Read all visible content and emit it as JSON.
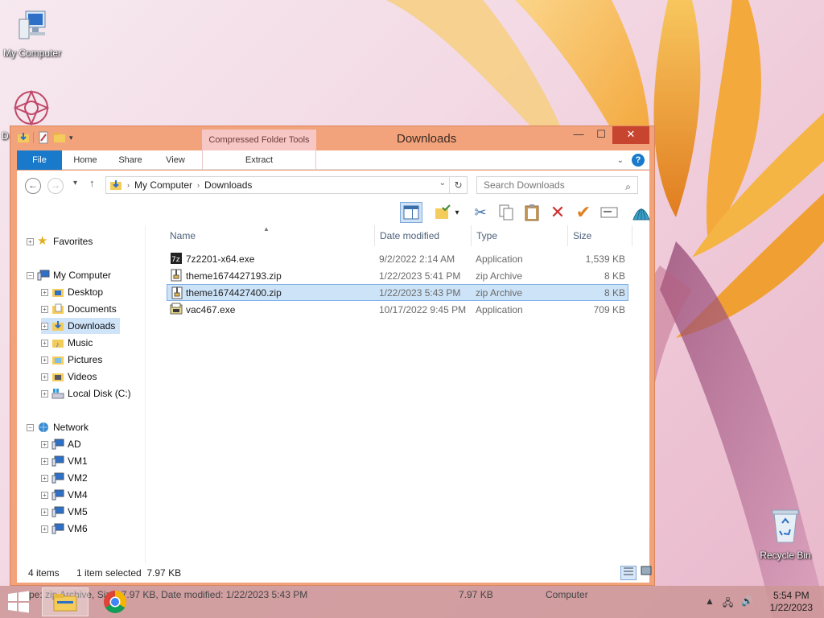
{
  "desktop": {
    "icons": [
      {
        "label": "My Computer"
      },
      {
        "label": "D"
      },
      {
        "label": "Recycle Bin"
      }
    ]
  },
  "window": {
    "title": "Downloads",
    "context_tab_header": "Compressed Folder Tools",
    "ribbon_tabs": {
      "file": "File",
      "home": "Home",
      "share": "Share",
      "view": "View",
      "extract": "Extract"
    },
    "help": "?",
    "controls": {
      "minimize": "—",
      "maximize": "☐",
      "close": "✕"
    }
  },
  "address_bar": {
    "back": "←",
    "forward": "→",
    "up": "↑",
    "recent": "▾",
    "path": [
      "My Computer",
      "Downloads"
    ],
    "separator": "›",
    "dropdown": "⌄",
    "refresh": "↻"
  },
  "search": {
    "placeholder": "Search Downloads",
    "icon": "⌕"
  },
  "nav_pane": {
    "favorites": "Favorites",
    "my_computer": "My Computer",
    "computer_children": [
      "Desktop",
      "Documents",
      "Downloads",
      "Music",
      "Pictures",
      "Videos",
      "Local Disk (C:)"
    ],
    "network": "Network",
    "network_children": [
      "AD",
      "VM1",
      "VM2",
      "VM4",
      "VM5",
      "VM6"
    ]
  },
  "file_list": {
    "columns": [
      "Name",
      "Date modified",
      "Type",
      "Size"
    ],
    "rows": [
      {
        "name": "7z2201-x64.exe",
        "date": "9/2/2022 2:14 AM",
        "type": "Application",
        "size": "1,539 KB",
        "icon": "7zip-icon"
      },
      {
        "name": "theme1674427193.zip",
        "date": "1/22/2023 5:41 PM",
        "type": "zip Archive",
        "size": "8 KB",
        "icon": "zip-icon"
      },
      {
        "name": "theme1674427400.zip",
        "date": "1/22/2023 5:43 PM",
        "type": "zip Archive",
        "size": "8 KB",
        "icon": "zip-icon",
        "selected": true
      },
      {
        "name": "vac467.exe",
        "date": "10/17/2022 9:45 PM",
        "type": "Application",
        "size": "709 KB",
        "icon": "installer-icon"
      }
    ]
  },
  "status_bar": {
    "items": "4 items",
    "selection": "1 item selected  7.97 KB"
  },
  "taskbar": {
    "details_text": "pe: zip Archive, Size: 7.97 KB, Date modified: 1/22/2023 5:43 PM",
    "details_size": "7.97 KB",
    "details_location": "Computer",
    "time": "5:54 PM",
    "date": "1/22/2023"
  },
  "colors": {
    "accent": "#1979ca",
    "window_frame": "#f3a37c",
    "selection": "#cce3f8",
    "close": "#c7442f"
  }
}
